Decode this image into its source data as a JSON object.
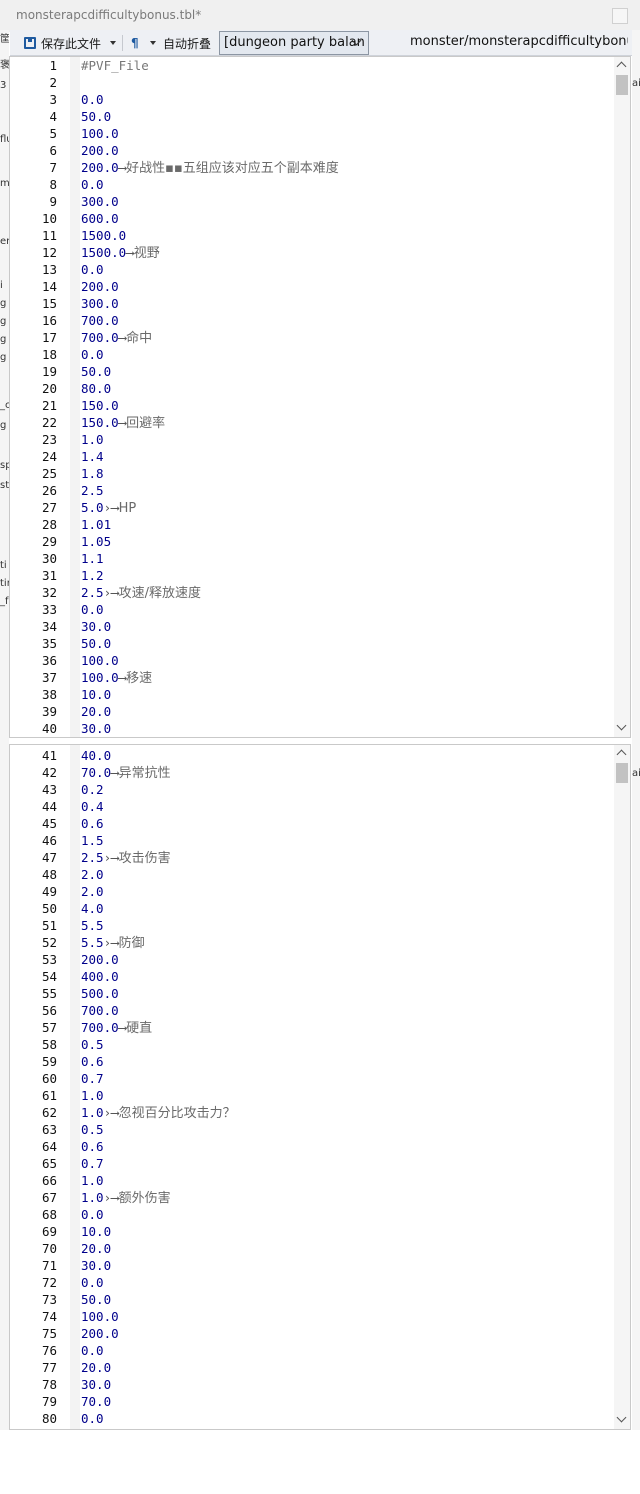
{
  "window": {
    "title": "monsterapcdifficultybonus.tbl*"
  },
  "toolbar": {
    "save_label": "保存此文件",
    "format_icon": "¶",
    "fold_label": "自动折叠",
    "select_value": "[dungeon party balan",
    "file_path": "monster/monsterapcdifficultybonus.tbl"
  },
  "icons": {
    "save": "save-icon",
    "format": "format-icon",
    "dropdown": "chevron-down-icon",
    "scroll_up": "chevron-up-icon",
    "scroll_down": "chevron-down-icon"
  },
  "colors": {
    "code_value": "#00008b",
    "comment": "#777777",
    "note": "#6a6a6a"
  },
  "editor_top": {
    "lines": [
      {
        "n": "1",
        "code": "#PVF_File"
      },
      {
        "n": "2",
        "code": ""
      },
      {
        "n": "3",
        "code": "0.0"
      },
      {
        "n": "4",
        "code": "50.0"
      },
      {
        "n": "5",
        "code": "100.0"
      },
      {
        "n": "6",
        "code": "200.0"
      },
      {
        "n": "7",
        "code": "200.0",
        "arrow": "⟶",
        "note": "好战性▪▪五组应该对应五个副本难度"
      },
      {
        "n": "8",
        "code": "0.0"
      },
      {
        "n": "9",
        "code": "300.0"
      },
      {
        "n": "10",
        "code": "600.0"
      },
      {
        "n": "11",
        "code": "1500.0"
      },
      {
        "n": "12",
        "code": "1500.0",
        "arrow": "⟶",
        "note": "视野"
      },
      {
        "n": "13",
        "code": "0.0"
      },
      {
        "n": "14",
        "code": "200.0"
      },
      {
        "n": "15",
        "code": "300.0"
      },
      {
        "n": "16",
        "code": "700.0"
      },
      {
        "n": "17",
        "code": "700.0",
        "arrow": "⟶",
        "note": "命中"
      },
      {
        "n": "18",
        "code": "0.0"
      },
      {
        "n": "19",
        "code": "50.0"
      },
      {
        "n": "20",
        "code": "80.0"
      },
      {
        "n": "21",
        "code": "150.0"
      },
      {
        "n": "22",
        "code": "150.0",
        "arrow": "⟶",
        "note": "回避率"
      },
      {
        "n": "23",
        "code": "1.0"
      },
      {
        "n": "24",
        "code": "1.4"
      },
      {
        "n": "25",
        "code": "1.8"
      },
      {
        "n": "26",
        "code": "2.5"
      },
      {
        "n": "27",
        "code": "5.0",
        "arrow": "›⟶",
        "note": "HP"
      },
      {
        "n": "28",
        "code": "1.01"
      },
      {
        "n": "29",
        "code": "1.05"
      },
      {
        "n": "30",
        "code": "1.1"
      },
      {
        "n": "31",
        "code": "1.2"
      },
      {
        "n": "32",
        "code": "2.5",
        "arrow": "›⟶",
        "note": "攻速/释放速度"
      },
      {
        "n": "33",
        "code": "0.0"
      },
      {
        "n": "34",
        "code": "30.0"
      },
      {
        "n": "35",
        "code": "50.0"
      },
      {
        "n": "36",
        "code": "100.0"
      },
      {
        "n": "37",
        "code": "100.0",
        "arrow": "⟶",
        "note": "移速"
      },
      {
        "n": "38",
        "code": "10.0"
      },
      {
        "n": "39",
        "code": "20.0"
      },
      {
        "n": "40",
        "code": "30.0"
      }
    ]
  },
  "editor_bottom": {
    "lines": [
      {
        "n": "41",
        "code": "40.0"
      },
      {
        "n": "42",
        "code": "70.0",
        "arrow": "⟶",
        "note": "异常抗性"
      },
      {
        "n": "43",
        "code": "0.2"
      },
      {
        "n": "44",
        "code": "0.4"
      },
      {
        "n": "45",
        "code": "0.6"
      },
      {
        "n": "46",
        "code": "1.5"
      },
      {
        "n": "47",
        "code": "2.5",
        "arrow": "›⟶",
        "note": "攻击伤害"
      },
      {
        "n": "48",
        "code": "2.0"
      },
      {
        "n": "49",
        "code": "2.0"
      },
      {
        "n": "50",
        "code": "4.0"
      },
      {
        "n": "51",
        "code": "5.5"
      },
      {
        "n": "52",
        "code": "5.5",
        "arrow": "›⟶",
        "note": "防御"
      },
      {
        "n": "53",
        "code": "200.0"
      },
      {
        "n": "54",
        "code": "400.0"
      },
      {
        "n": "55",
        "code": "500.0"
      },
      {
        "n": "56",
        "code": "700.0"
      },
      {
        "n": "57",
        "code": "700.0",
        "arrow": "⟶",
        "note": "硬直"
      },
      {
        "n": "58",
        "code": "0.5"
      },
      {
        "n": "59",
        "code": "0.6"
      },
      {
        "n": "60",
        "code": "0.7"
      },
      {
        "n": "61",
        "code": "1.0"
      },
      {
        "n": "62",
        "code": "1.0",
        "arrow": "›⟶",
        "note": "忽视百分比攻击力？"
      },
      {
        "n": "63",
        "code": "0.5"
      },
      {
        "n": "64",
        "code": "0.6"
      },
      {
        "n": "65",
        "code": "0.7"
      },
      {
        "n": "66",
        "code": "1.0"
      },
      {
        "n": "67",
        "code": "1.0",
        "arrow": "›⟶",
        "note": "额外伤害"
      },
      {
        "n": "68",
        "code": "0.0"
      },
      {
        "n": "69",
        "code": "10.0"
      },
      {
        "n": "70",
        "code": "20.0"
      },
      {
        "n": "71",
        "code": "30.0"
      },
      {
        "n": "72",
        "code": "0.0"
      },
      {
        "n": "73",
        "code": "50.0"
      },
      {
        "n": "74",
        "code": "100.0"
      },
      {
        "n": "75",
        "code": "200.0"
      },
      {
        "n": "76",
        "code": "0.0"
      },
      {
        "n": "77",
        "code": "20.0"
      },
      {
        "n": "78",
        "code": "30.0"
      },
      {
        "n": "79",
        "code": "70.0"
      },
      {
        "n": "80",
        "code": "0.0"
      }
    ]
  },
  "background_left": {
    "fragments": [
      "筐",
      "褒",
      "3",
      "flu",
      "m",
      "er",
      "i",
      "g",
      "g",
      "g",
      "g",
      "_c",
      "g",
      "sp",
      "st",
      "ti",
      "tir",
      "_f"
    ]
  },
  "background_right": {
    "fragments": [
      "ai",
      "ai"
    ]
  }
}
